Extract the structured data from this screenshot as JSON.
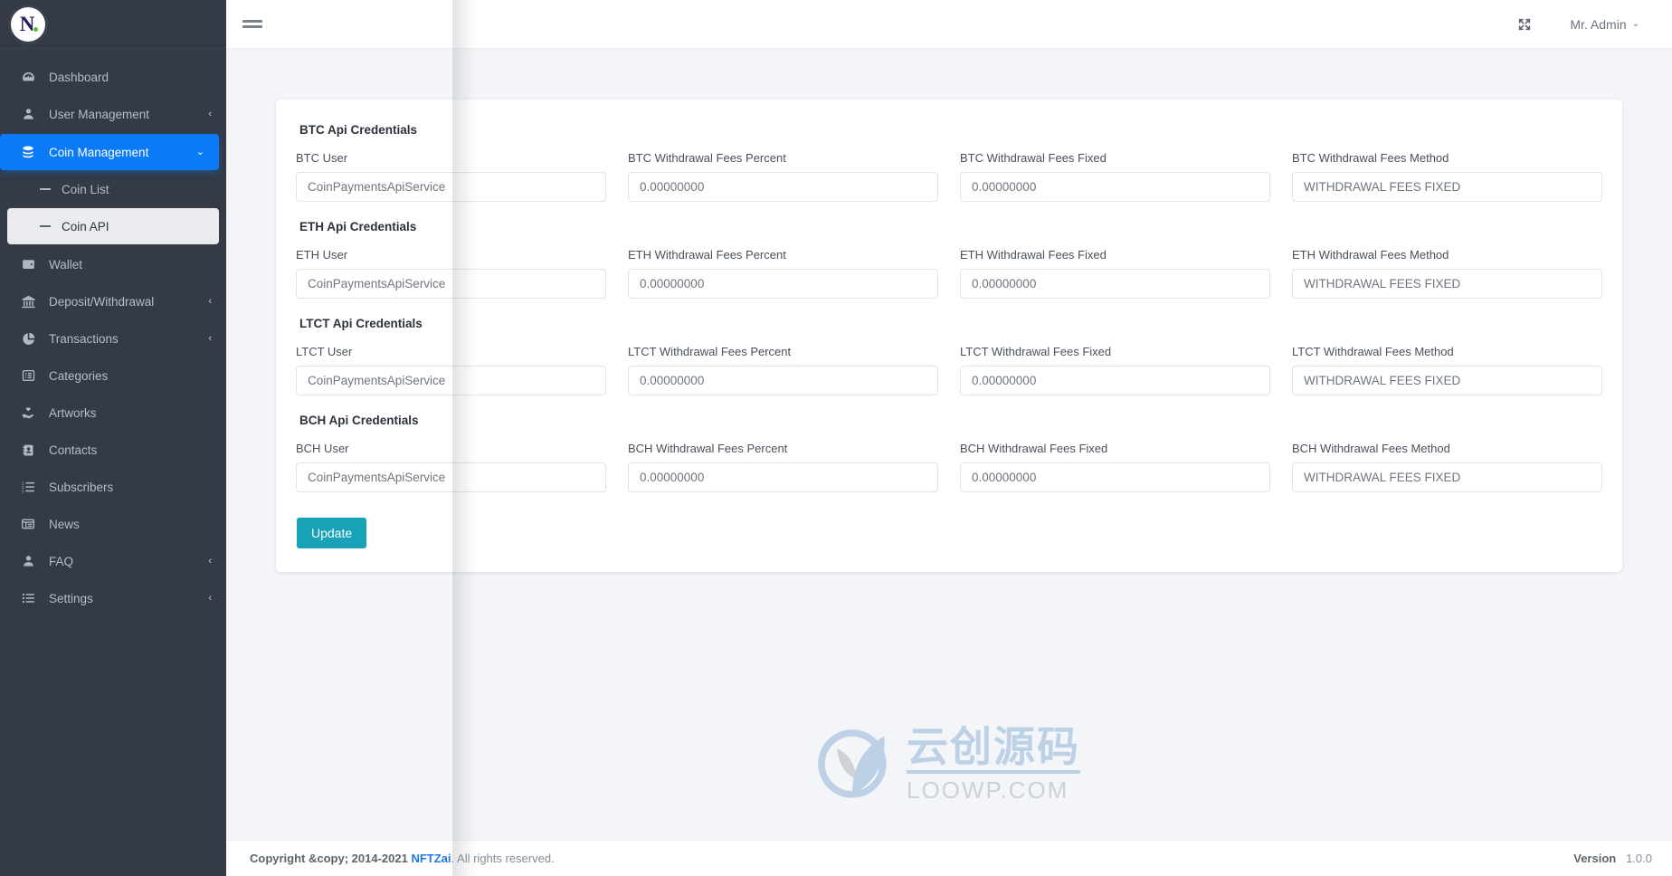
{
  "brand": {
    "letter": "N",
    "alt": "NFTZai"
  },
  "sidebar": {
    "items": [
      {
        "label": "Dashboard",
        "icon": "dashboard-icon",
        "caret": "",
        "active": false
      },
      {
        "label": "User Management",
        "icon": "user-icon",
        "caret": "‹",
        "active": false
      },
      {
        "label": "Coin Management",
        "icon": "coins-icon",
        "caret": "⌄",
        "active": true
      },
      {
        "label": "Wallet",
        "icon": "wallet-icon",
        "caret": "",
        "active": false
      },
      {
        "label": "Deposit/Withdrawal",
        "icon": "bank-icon",
        "caret": "‹",
        "active": false
      },
      {
        "label": "Transactions",
        "icon": "pie-chart-icon",
        "caret": "‹",
        "active": false
      },
      {
        "label": "Categories",
        "icon": "list-box-icon",
        "caret": "",
        "active": false
      },
      {
        "label": "Artworks",
        "icon": "hand-heart-icon",
        "caret": "",
        "active": false
      },
      {
        "label": "Contacts",
        "icon": "contact-book-icon",
        "caret": "",
        "active": false
      },
      {
        "label": "Subscribers",
        "icon": "ordered-list-icon",
        "caret": "",
        "active": false
      },
      {
        "label": "News",
        "icon": "newspaper-icon",
        "caret": "",
        "active": false
      },
      {
        "label": "FAQ",
        "icon": "user-icon",
        "caret": "‹",
        "active": false
      },
      {
        "label": "Settings",
        "icon": "list-icon",
        "caret": "‹",
        "active": false
      }
    ],
    "submenu": [
      {
        "label": "Coin List",
        "current": false
      },
      {
        "label": "Coin API",
        "current": true
      }
    ]
  },
  "topbar": {
    "menu_toggle": "hamburger-icon",
    "fullscreen": "expand-icon",
    "user_name": "Mr. Admin",
    "user_caret": "⌄"
  },
  "form": {
    "sections": [
      {
        "title": "BTC Api Credentials",
        "fields": [
          {
            "label": "BTC User",
            "placeholder": "CoinPaymentsApiService",
            "value": ""
          },
          {
            "label": "BTC Withdrawal Fees Percent",
            "placeholder": "0.00000000",
            "value": ""
          },
          {
            "label": "BTC Withdrawal Fees Fixed",
            "placeholder": "0.00000000",
            "value": ""
          },
          {
            "label": "BTC Withdrawal Fees Method",
            "placeholder": "WITHDRAWAL FEES FIXED",
            "value": ""
          }
        ]
      },
      {
        "title": "ETH Api Credentials",
        "fields": [
          {
            "label": "ETH User",
            "placeholder": "CoinPaymentsApiService",
            "value": ""
          },
          {
            "label": "ETH Withdrawal Fees Percent",
            "placeholder": "0.00000000",
            "value": ""
          },
          {
            "label": "ETH Withdrawal Fees Fixed",
            "placeholder": "0.00000000",
            "value": ""
          },
          {
            "label": "ETH Withdrawal Fees Method",
            "placeholder": "WITHDRAWAL FEES FIXED",
            "value": ""
          }
        ]
      },
      {
        "title": "LTCT Api Credentials",
        "fields": [
          {
            "label": "LTCT User",
            "placeholder": "CoinPaymentsApiService",
            "value": ""
          },
          {
            "label": "LTCT Withdrawal Fees Percent",
            "placeholder": "0.00000000",
            "value": ""
          },
          {
            "label": "LTCT Withdrawal Fees Fixed",
            "placeholder": "0.00000000",
            "value": ""
          },
          {
            "label": "LTCT Withdrawal Fees Method",
            "placeholder": "WITHDRAWAL FEES FIXED",
            "value": ""
          }
        ]
      },
      {
        "title": "BCH Api Credentials",
        "fields": [
          {
            "label": "BCH User",
            "placeholder": "CoinPaymentsApiService",
            "value": ""
          },
          {
            "label": "BCH Withdrawal Fees Percent",
            "placeholder": "0.00000000",
            "value": ""
          },
          {
            "label": "BCH Withdrawal Fees Fixed",
            "placeholder": "0.00000000",
            "value": ""
          },
          {
            "label": "BCH Withdrawal Fees Method",
            "placeholder": "WITHDRAWAL FEES FIXED",
            "value": ""
          }
        ]
      }
    ],
    "update_label": "Update"
  },
  "watermark": {
    "cn": "云创源码",
    "en": "LOOWP.COM"
  },
  "footer": {
    "copyright_strong": "Copyright &copy; 2014-2021",
    "brand_link": "NFTZai",
    "copyright_rest": ". All rights reserved.",
    "version_label": "Version",
    "version_value": "1.0.0"
  },
  "colors": {
    "sidebar_bg": "#343a46",
    "accent_blue": "#0b7af5",
    "update_teal": "#17a2b8",
    "link_blue": "#1e7ae0",
    "content_bg": "#f4f5f8"
  }
}
